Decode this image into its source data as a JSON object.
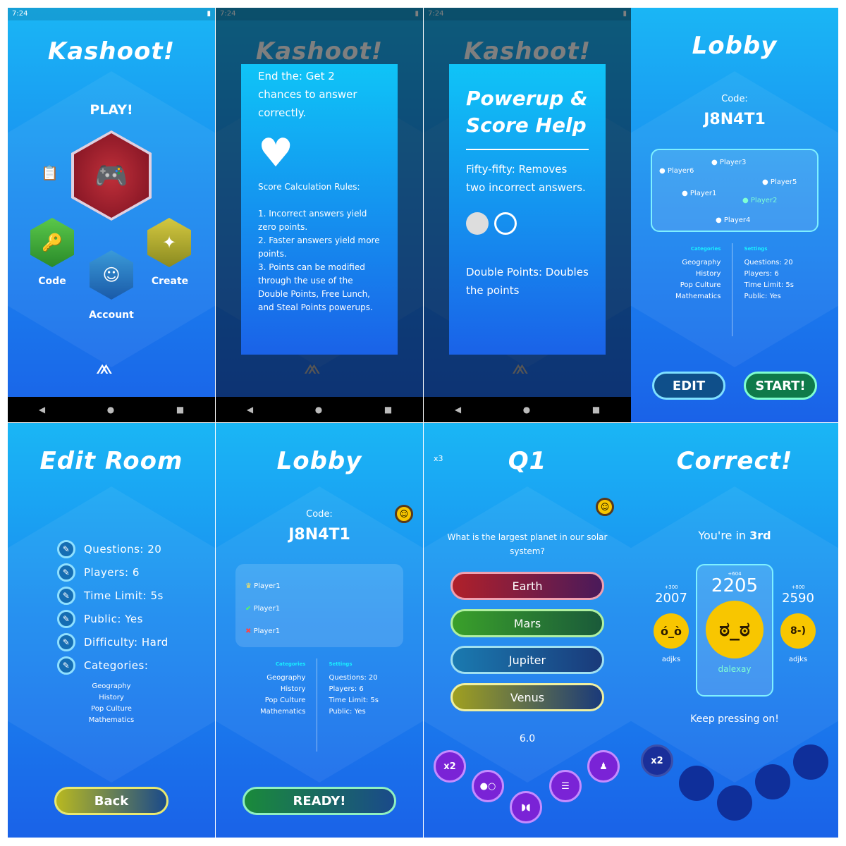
{
  "status": {
    "time": "7:24"
  },
  "home": {
    "title": "Kashoot!",
    "play": "PLAY!",
    "code": "Code",
    "create": "Create",
    "account": "Account"
  },
  "help1": {
    "top": "End the: Get 2 chances to answer correctly.",
    "rules_title": "Score Calculation Rules:",
    "rules": [
      "1. Incorrect answers yield zero points.",
      "2. Faster answers yield more points.",
      "3. Points can be modified through the use of the Double Points, Free Lunch, and Steal Points powerups."
    ]
  },
  "help2": {
    "title": "Powerup & Score Help",
    "ff": "Fifty-fifty: Removes two incorrect answers.",
    "dp": "Double Points: Doubles the points"
  },
  "lobby": {
    "title": "Lobby",
    "code_label": "Code:",
    "code": "J8N4T1",
    "players": [
      "Player6",
      "Player3",
      "Player1",
      "Player5",
      "Player2",
      "Player4"
    ],
    "edit": "EDIT",
    "start": "START!"
  },
  "cats": {
    "head": "Categories",
    "items": [
      "Geography",
      "History",
      "Pop Culture",
      "Mathematics"
    ]
  },
  "sets": {
    "head": "Settings",
    "items": [
      "Questions: 20",
      "Players: 6",
      "Time Limit: 5s",
      "Public: Yes"
    ]
  },
  "editroom": {
    "title": "Edit Room",
    "rows": [
      "Questions: 20",
      "Players: 6",
      "Time Limit: 5s",
      "Public: Yes",
      "Difficulty: Hard",
      "Categories:"
    ],
    "back": "Back"
  },
  "lobby2": {
    "players": [
      "Player1",
      "Player1",
      "Player1"
    ],
    "ready": "READY!"
  },
  "quiz": {
    "mult": "x3",
    "title": "Q1",
    "question": "What is the largest planet in our solar system?",
    "answers": [
      "Earth",
      "Mars",
      "Jupiter",
      "Venus"
    ],
    "timer": "6.0",
    "x2": "x2"
  },
  "correct": {
    "title": "Correct!",
    "place_prefix": "You're in ",
    "place": "3rd",
    "left_bonus": "+300",
    "left_score": "2007",
    "left_name": "adjks",
    "mid_bonus": "+604",
    "mid_score": "2205",
    "mid_name": "dalexay",
    "right_bonus": "+800",
    "right_score": "2590",
    "right_name": "adjks",
    "msg": "Keep pressing on!",
    "x2": "x2"
  }
}
